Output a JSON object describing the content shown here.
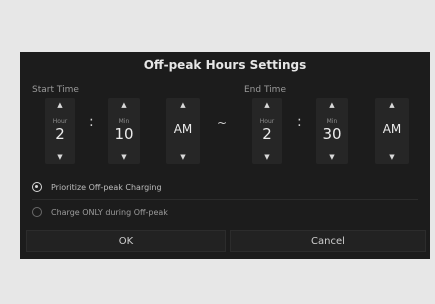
{
  "dialog": {
    "title": "Off-peak Hours Settings",
    "start_label": "Start Time",
    "end_label": "End Time"
  },
  "start": {
    "hour_unit": "Hour",
    "hour_value": "2",
    "min_unit": "Min",
    "min_value": "10",
    "ampm": "AM"
  },
  "end": {
    "hour_unit": "Hour",
    "hour_value": "2",
    "min_unit": "Min",
    "min_value": "30",
    "ampm": "AM"
  },
  "separators": {
    "colon": ":",
    "tilde": "~"
  },
  "arrows": {
    "up": "▲",
    "down": "▼"
  },
  "options": [
    {
      "label": "Prioritize Off-peak Charging",
      "selected": true
    },
    {
      "label": "Charge ONLY during Off-peak",
      "selected": false
    }
  ],
  "buttons": {
    "ok": "OK",
    "cancel": "Cancel"
  },
  "colors": {
    "background": "#e7e7e7",
    "panel": "#1c1c1c",
    "text": "#e2e2e2"
  },
  "icons": {
    "up": "up-arrow-icon",
    "down": "down-arrow-icon",
    "radio_on": "radio-selected-icon",
    "radio_off": "radio-unselected-icon"
  }
}
